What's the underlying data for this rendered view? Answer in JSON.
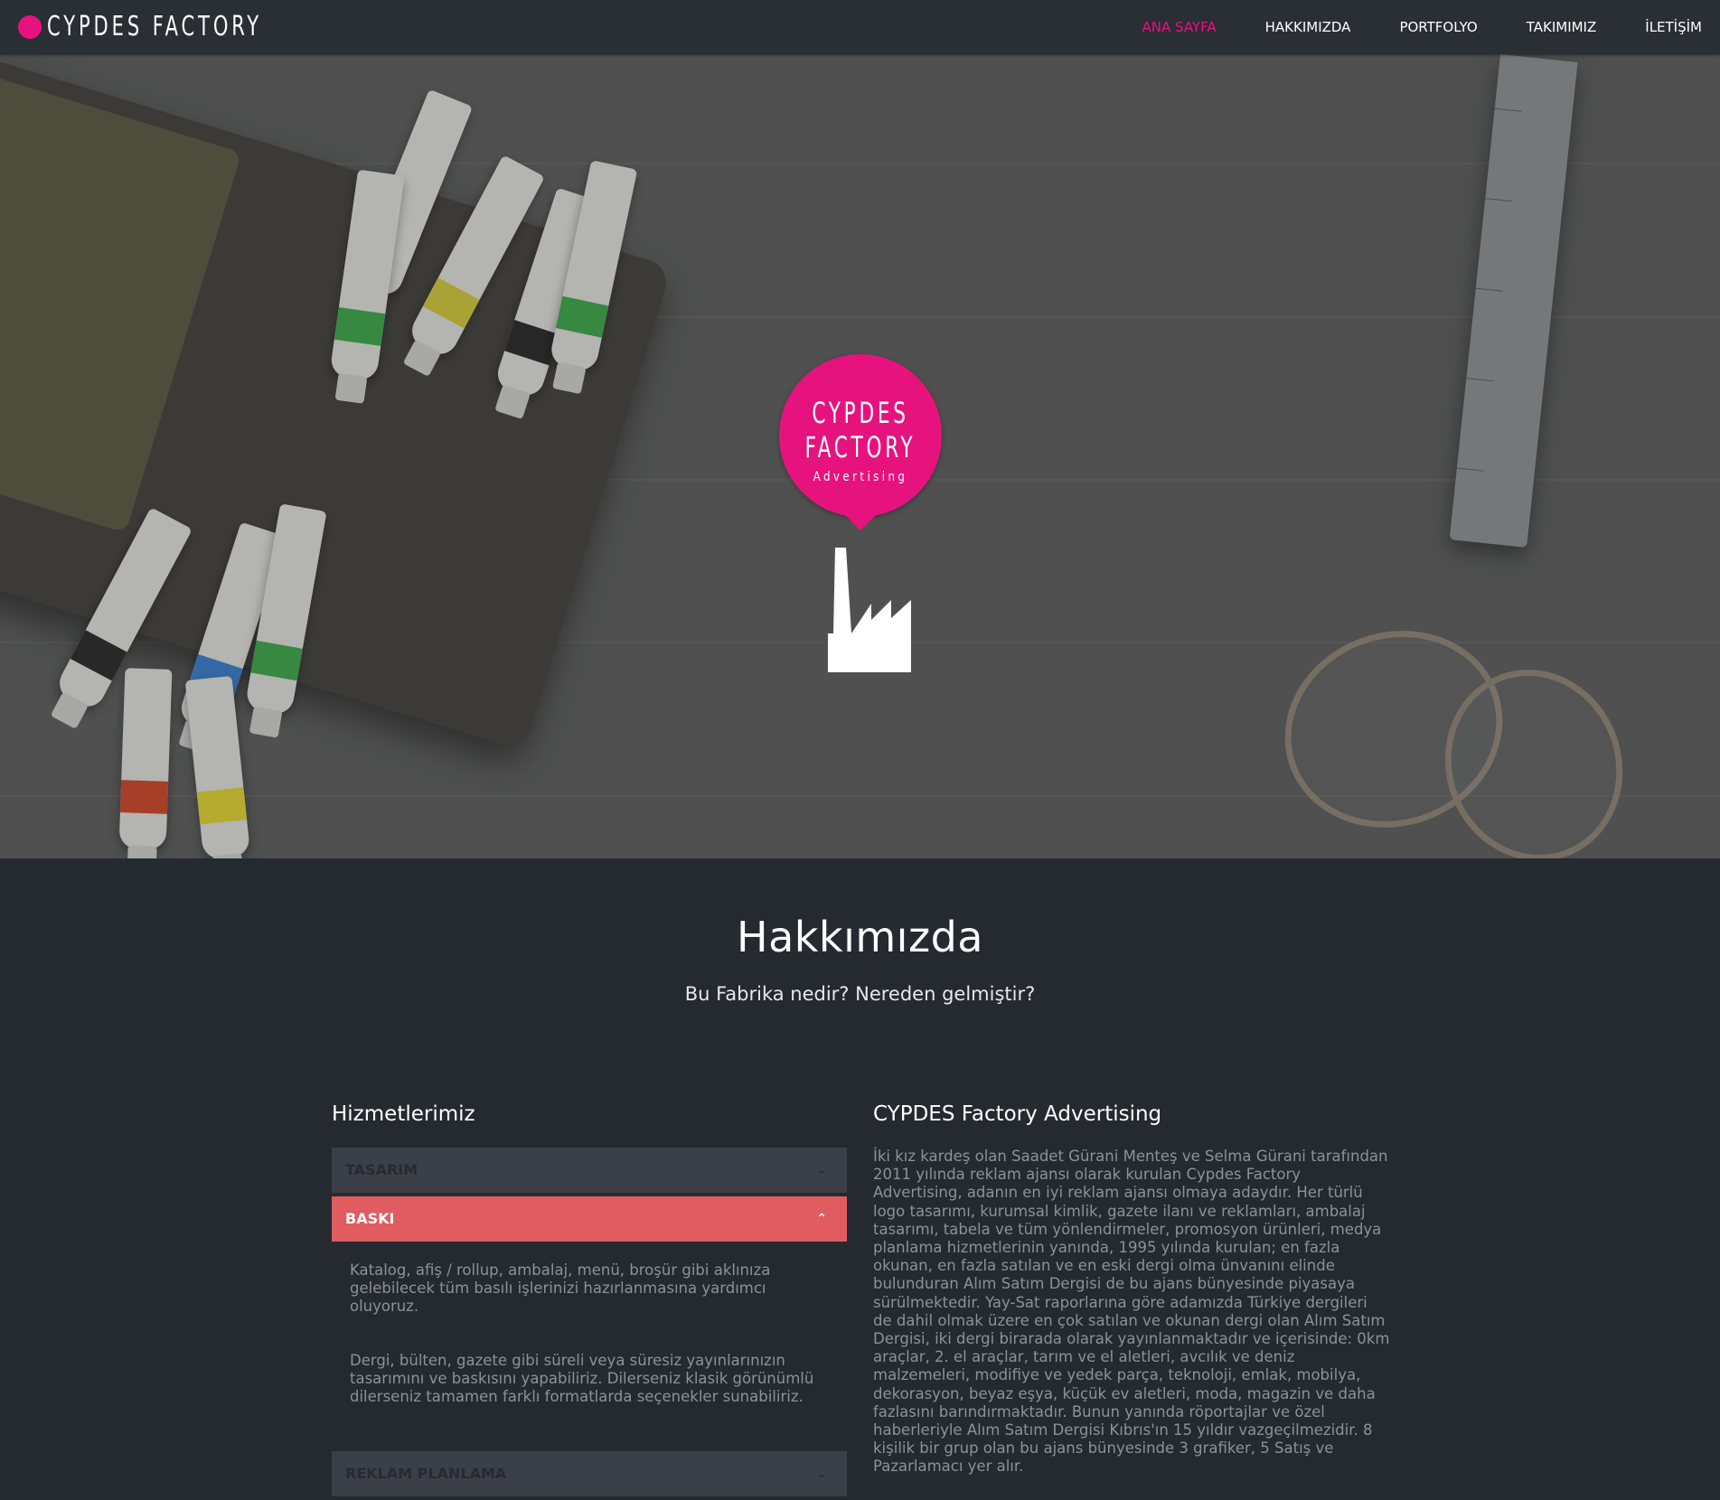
{
  "brand": {
    "name": "CYPDES FACTORY"
  },
  "nav": {
    "items": [
      {
        "label": "ANA SAYFA",
        "active": true
      },
      {
        "label": "HAKKIMIZDA",
        "active": false
      },
      {
        "label": "PORTFOLYO",
        "active": false
      },
      {
        "label": "TAKIMIMIZ",
        "active": false
      },
      {
        "label": "İLETİŞİM",
        "active": false
      }
    ]
  },
  "hero": {
    "badge": {
      "line1": "CYPDES",
      "line2": "FACTORY",
      "line3": "Advertising"
    }
  },
  "about": {
    "title": "Hakkımızda",
    "subtitle": "Bu Fabrika nedir? Nereden gelmiştir?",
    "services": {
      "title": "Hizmetlerimiz",
      "items": [
        {
          "label": "TASARIM",
          "open": false
        },
        {
          "label": "BASKI",
          "open": true,
          "paragraphs": [
            "Katalog, afiş / rollup, ambalaj, menü, broşür gibi aklınıza gelebilecek tüm basılı işlerinizi hazırlanmasına yardımcı oluyoruz.",
            "Dergi, bülten, gazete gibi süreli veya süresiz yayınlarınızın tasarımını ve baskısını yapabiliriz. Dilerseniz klasik görünümlü dilerseniz tamamen farklı formatlarda seçenekler sunabiliriz."
          ]
        },
        {
          "label": "REKLAM PLANLAMA",
          "open": false
        }
      ]
    },
    "company": {
      "title": "CYPDES Factory Advertising",
      "text": "İki kız kardeş olan Saadet Gürani Menteş ve Selma Gürani tarafından 2011 yılında reklam ajansı olarak kurulan Cypdes Factory Advertising, adanın en iyi reklam ajansı olmaya adaydır. Her türlü logo tasarımı, kurumsal kimlik, gazete ilanı ve reklamları, ambalaj tasarımı, tabela ve tüm yönlendirmeler, promosyon ürünleri, medya planlama hizmetlerinin yanında, 1995 yılında kurulan; en fazla okunan, en fazla satılan ve en eski dergi olma ünvanını elinde bulunduran Alım Satım Dergisi de bu ajans bünyesinde piyasaya sürülmektedir. Yay-Sat raporlarına göre adamızda Türkiye dergileri de dahil olmak üzere en çok satılan ve okunan dergi olan Alım Satım Dergisi, iki dergi birarada olarak yayınlanmaktadır ve içerisinde: 0km araçlar, 2. el araçlar, tarım ve el aletleri, avcılık ve deniz malzemeleri, modifiye ve yedek parça, teknoloji, emlak, mobilya, dekorasyon, beyaz eşya, küçük ev aletleri, moda, magazin ve daha fazlasını barındırmaktadır. Bunun yanında röportajlar ve özel haberleriyle Alım Satım Dergisi Kıbrıs'ın 15 yıldır vazgeçilmezidir. 8 kişilik bir grup olan bu ajans bünyesinde 3 grafiker, 5 Satış ve Pazarlamacı yer alır."
    }
  },
  "colors": {
    "accent": "#e6137e",
    "accordion_open": "#e05c60",
    "accordion_closed": "#3b3f47",
    "background": "#252930",
    "navbar": "#2a2e35"
  },
  "icons": {
    "logo_dot": "brand-dot-icon",
    "factory": "factory-icon",
    "chevron_down": "chevron-down-icon",
    "chevron_up": "chevron-up-icon"
  }
}
